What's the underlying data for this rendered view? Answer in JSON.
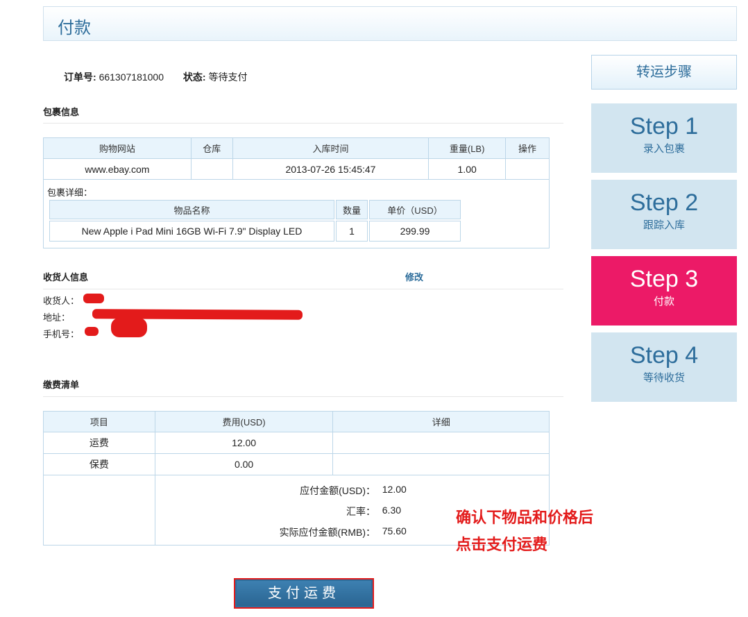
{
  "page_title": "付款",
  "order": {
    "no_label": "订单号:",
    "no_value": "661307181000",
    "status_label": "状态:",
    "status_value": "等待支付"
  },
  "package": {
    "section_title": "包裹信息",
    "headers": [
      "购物网站",
      "仓库",
      "入库时间",
      "重量(LB)",
      "操作"
    ],
    "row": [
      "www.ebay.com",
      "",
      "2013-07-26 15:45:47",
      "1.00",
      ""
    ],
    "detail_label": "包裹详细：",
    "item_headers": [
      "物品名称",
      "数量",
      "单价（USD）"
    ],
    "item_row": [
      "New Apple i Pad Mini 16GB Wi-Fi 7.9\" Display LED",
      "1",
      "299.99"
    ]
  },
  "receiver": {
    "section_title": "收货人信息",
    "edit_label": "修改",
    "name_label": "收货人：",
    "address_label": "地址：",
    "phone_label": "手机号："
  },
  "fees": {
    "section_title": "缴费清单",
    "headers": [
      "项目",
      "费用(USD)",
      "详细"
    ],
    "rows": [
      {
        "item": "运费",
        "cost": "12.00",
        "detail": ""
      },
      {
        "item": "保费",
        "cost": "0.00",
        "detail": ""
      }
    ],
    "summary": [
      {
        "label": "应付金额(USD)：",
        "value": "12.00"
      },
      {
        "label": "汇率：",
        "value": "6.30"
      },
      {
        "label": "实际应付金额(RMB)：",
        "value": "75.60"
      }
    ]
  },
  "note": {
    "line1": "确认下物品和价格后",
    "line2": "点击支付运费"
  },
  "pay_button": "支付运费",
  "steps": {
    "title": "转运步骤",
    "items": [
      {
        "num": "Step 1",
        "label": "录入包裹"
      },
      {
        "num": "Step 2",
        "label": "跟踪入库"
      },
      {
        "num": "Step 3",
        "label": "付款"
      },
      {
        "num": "Step 4",
        "label": "等待收货"
      }
    ],
    "active_index": 2,
    "colors": {
      "active": "#ec1a67",
      "inactive": "#d2e5f0",
      "accent": "#2d6d9b"
    }
  }
}
